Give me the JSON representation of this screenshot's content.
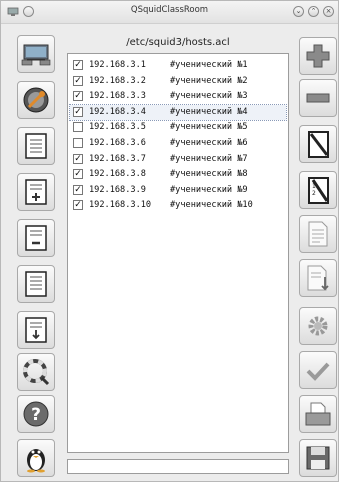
{
  "window": {
    "title": "QSquidClassRoom"
  },
  "path": "/etc/squid3/hosts.acl",
  "hosts": [
    {
      "checked": true,
      "ip": "192.168.3.1",
      "desc": "#ученический №1"
    },
    {
      "checked": true,
      "ip": "192.168.3.2",
      "desc": "#ученический №2"
    },
    {
      "checked": true,
      "ip": "192.168.3.3",
      "desc": "#ученический №3"
    },
    {
      "checked": true,
      "ip": "192.168.3.4",
      "desc": "#ученический №4"
    },
    {
      "checked": false,
      "ip": "192.168.3.5",
      "desc": "#ученический №5"
    },
    {
      "checked": false,
      "ip": "192.168.3.6",
      "desc": "#ученический №6"
    },
    {
      "checked": true,
      "ip": "192.168.3.7",
      "desc": "#ученический №7"
    },
    {
      "checked": true,
      "ip": "192.168.3.8",
      "desc": "#ученический №8"
    },
    {
      "checked": true,
      "ip": "192.168.3.9",
      "desc": "#ученический №9"
    },
    {
      "checked": true,
      "ip": "192.168.3.10",
      "desc": "#ученический №10"
    }
  ],
  "selected_index": 3,
  "left_toolbar": [
    "network-computers-icon",
    "squid-settings-icon",
    "list-document-icon",
    "list-add-icon",
    "list-remove-icon",
    "list-edit-icon",
    "list-download-icon",
    "lifebuoy-search-icon",
    "help-icon",
    "linux-penguin-icon"
  ],
  "right_toolbar": [
    "add-icon",
    "remove-icon",
    "edit-notebook-icon",
    "numbered-notebook-icon",
    "document-icon",
    "document-import-icon",
    "settings-gear-icon",
    "apply-check-icon",
    "printer-icon",
    "save-floppy-icon"
  ]
}
